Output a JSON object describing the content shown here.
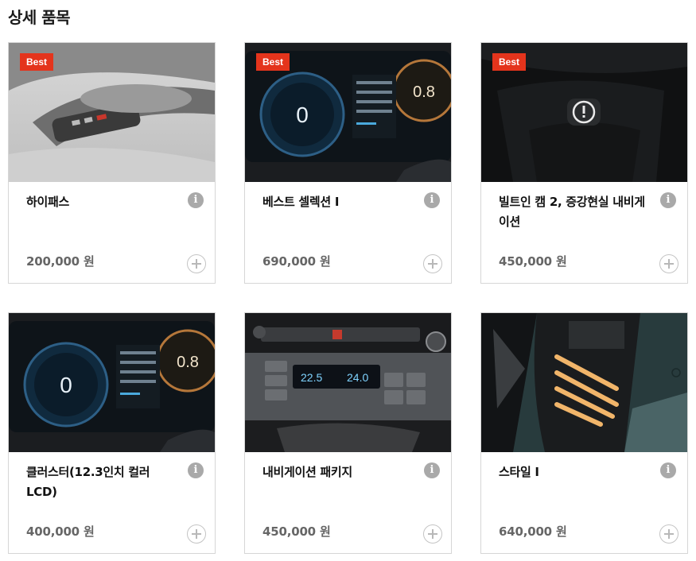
{
  "section_title": "상세 품목",
  "colors": {
    "badge": "#e4341c",
    "border": "#d6d6d6",
    "price": "#666666",
    "info_icon": "#a9a9a9"
  },
  "items": [
    {
      "name": "하이패스",
      "price": "200,000 원",
      "badge": "Best",
      "image": "overhead-console-photo",
      "info_icon": "info-icon",
      "add_icon": "plus-circle-icon"
    },
    {
      "name": "베스트 셀렉션 Ⅰ",
      "price": "690,000 원",
      "badge": "Best",
      "image": "digital-cluster-photo",
      "info_icon": "info-icon",
      "add_icon": "plus-circle-icon"
    },
    {
      "name": "빌트인 캠 2, 증강현실 내비게이션",
      "price": "450,000 원",
      "badge": "Best",
      "image": "builtin-cam-photo",
      "info_icon": "info-icon",
      "add_icon": "plus-circle-icon"
    },
    {
      "name": "클러스터(12.3인치 컬러 LCD)",
      "price": "400,000 원",
      "badge": "",
      "image": "digital-cluster-photo",
      "info_icon": "info-icon",
      "add_icon": "plus-circle-icon"
    },
    {
      "name": "내비게이션 패키지",
      "price": "450,000 원",
      "badge": "",
      "image": "climate-control-panel-photo",
      "info_icon": "info-icon",
      "add_icon": "plus-circle-icon"
    },
    {
      "name": "스타일 Ⅰ",
      "price": "640,000 원",
      "badge": "",
      "image": "headlamp-photo",
      "info_icon": "info-icon",
      "add_icon": "plus-circle-icon"
    }
  ]
}
